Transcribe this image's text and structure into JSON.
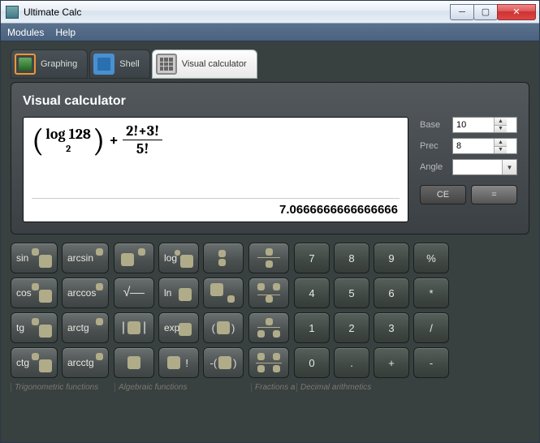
{
  "window": {
    "title": "Ultimate Calc"
  },
  "menu": {
    "modules": "Modules",
    "help": "Help"
  },
  "tabs": {
    "graphing": "Graphing",
    "shell": "Shell",
    "visual": "Visual calculator"
  },
  "panel": {
    "title": "Visual calculator",
    "result": "7.0666666666666666",
    "expr": {
      "log_label": "log",
      "log_arg": "128",
      "log_base": "2",
      "plus": "+",
      "frac_num": "2!+3!",
      "frac_den": "5!"
    }
  },
  "settings": {
    "base_label": "Base",
    "base_value": "10",
    "prec_label": "Prec",
    "prec_value": "8",
    "angle_label": "Angle",
    "angle_value": "",
    "ce": "CE",
    "eq": "="
  },
  "keys": {
    "sin": "sin",
    "arcsin": "arcsin",
    "cos": "cos",
    "arccos": "arccos",
    "tg": "tg",
    "arctg": "arctg",
    "ctg": "ctg",
    "arcctg": "arcctg",
    "log": "log",
    "ln": "ln",
    "exp": "exp",
    "bang": "!",
    "sqrt": "√",
    "n7": "7",
    "n8": "8",
    "n9": "9",
    "pct": "%",
    "n4": "4",
    "n5": "5",
    "n6": "6",
    "mul": "*",
    "n1": "1",
    "n2": "2",
    "n3": "3",
    "div": "/",
    "n0": "0",
    "dot": ".",
    "plus": "+",
    "minus": "-",
    "lparen": "(",
    "rparen": ")",
    "pipe": "|"
  },
  "footer": {
    "trig": "Trigonometric functions",
    "alg": "Algebraic functions",
    "frac": "Fractions a",
    "dec": "Decimal arithmetics"
  }
}
